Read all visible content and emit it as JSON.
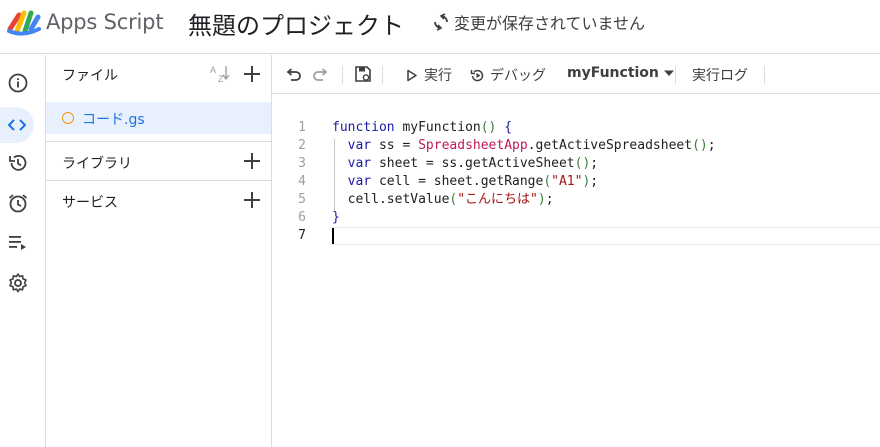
{
  "header": {
    "app_name": "Apps Script",
    "project_title": "無題のプロジェクト",
    "save_status": "変更が保存されていません"
  },
  "rail": {
    "items": [
      {
        "icon": "info-icon",
        "label": "概要"
      },
      {
        "icon": "code-icon",
        "label": "エディタ",
        "active": true
      },
      {
        "icon": "history-icon",
        "label": "デプロイ"
      },
      {
        "icon": "alarm-icon",
        "label": "トリガー"
      },
      {
        "icon": "executions-icon",
        "label": "実行数"
      },
      {
        "icon": "gear-icon",
        "label": "プロジェクトの設定"
      }
    ]
  },
  "files": {
    "title": "ファイル",
    "sort_icon": "sort-az-icon",
    "items": [
      {
        "name": "コード.gs",
        "selected": true
      }
    ],
    "libraries_label": "ライブラリ",
    "services_label": "サービス"
  },
  "toolbar": {
    "run_label": "実行",
    "debug_label": "デバッグ",
    "function_name": "myFunction",
    "log_label": "実行ログ"
  },
  "editor": {
    "lines": [
      "function myFunction() {",
      "  var ss = SpreadsheetApp.getActiveSpreadsheet();",
      "  var sheet = ss.getActiveSheet();",
      "  var cell = sheet.getRange(\"A1\");",
      "  cell.setValue(\"こんにちは\");",
      "}",
      ""
    ],
    "line_numbers": [
      "1",
      "2",
      "3",
      "4",
      "5",
      "6",
      "7"
    ]
  },
  "colors": {
    "accent": "#1a73e8",
    "selection_bg": "#e8f0fe",
    "file_dot": "#f29900",
    "keyword": "#1a1aa6",
    "class_name": "#c2185b",
    "string": "#a31515",
    "border": "#dadce0"
  }
}
